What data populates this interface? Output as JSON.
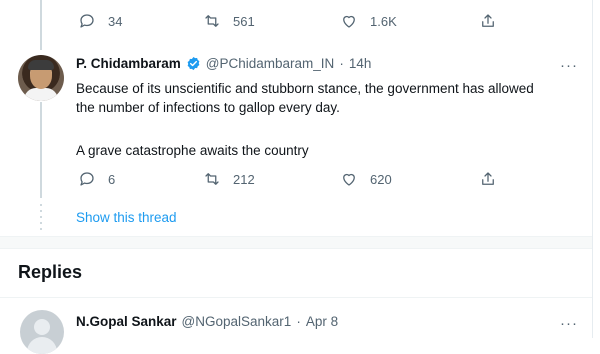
{
  "top_actions": {
    "reply_count": "34",
    "retweet_count": "561",
    "like_count": "1.6K"
  },
  "tweet": {
    "author_name": "P. Chidambaram",
    "handle": "@PChidambaram_IN",
    "separator": "·",
    "time": "14h",
    "more": "···",
    "line1": "Because of its unscientific and stubborn stance, the government has allowed",
    "line2": "the number of infections to gallop every day.",
    "line3": "A grave catastrophe awaits the country",
    "reply_count": "6",
    "retweet_count": "212",
    "like_count": "620",
    "show_thread": "Show this thread"
  },
  "replies": {
    "title": "Replies",
    "first": {
      "author_name": "N.Gopal Sankar",
      "handle": "@NGopalSankar1",
      "separator": "·",
      "date": "Apr 8",
      "more": "···"
    }
  },
  "colors": {
    "accent": "#1d9bf0",
    "muted": "#536471",
    "text": "#0f1419"
  },
  "icons": [
    "reply-icon",
    "retweet-icon",
    "like-icon",
    "share-icon",
    "verified-badge-icon",
    "more-icon"
  ]
}
